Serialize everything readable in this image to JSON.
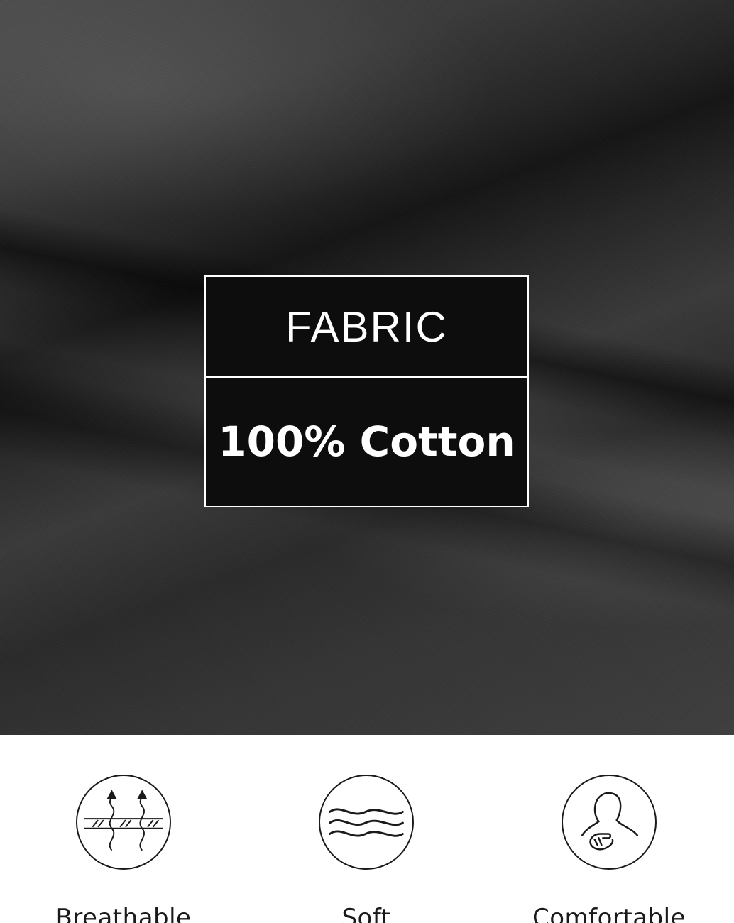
{
  "label": {
    "title": "FABRIC",
    "value": "100% Cotton"
  },
  "features": [
    {
      "icon": "breathable-icon",
      "label": "Breathable"
    },
    {
      "icon": "soft-icon",
      "label": "Soft"
    },
    {
      "icon": "comfortable-icon",
      "label": "Comfortable"
    }
  ]
}
